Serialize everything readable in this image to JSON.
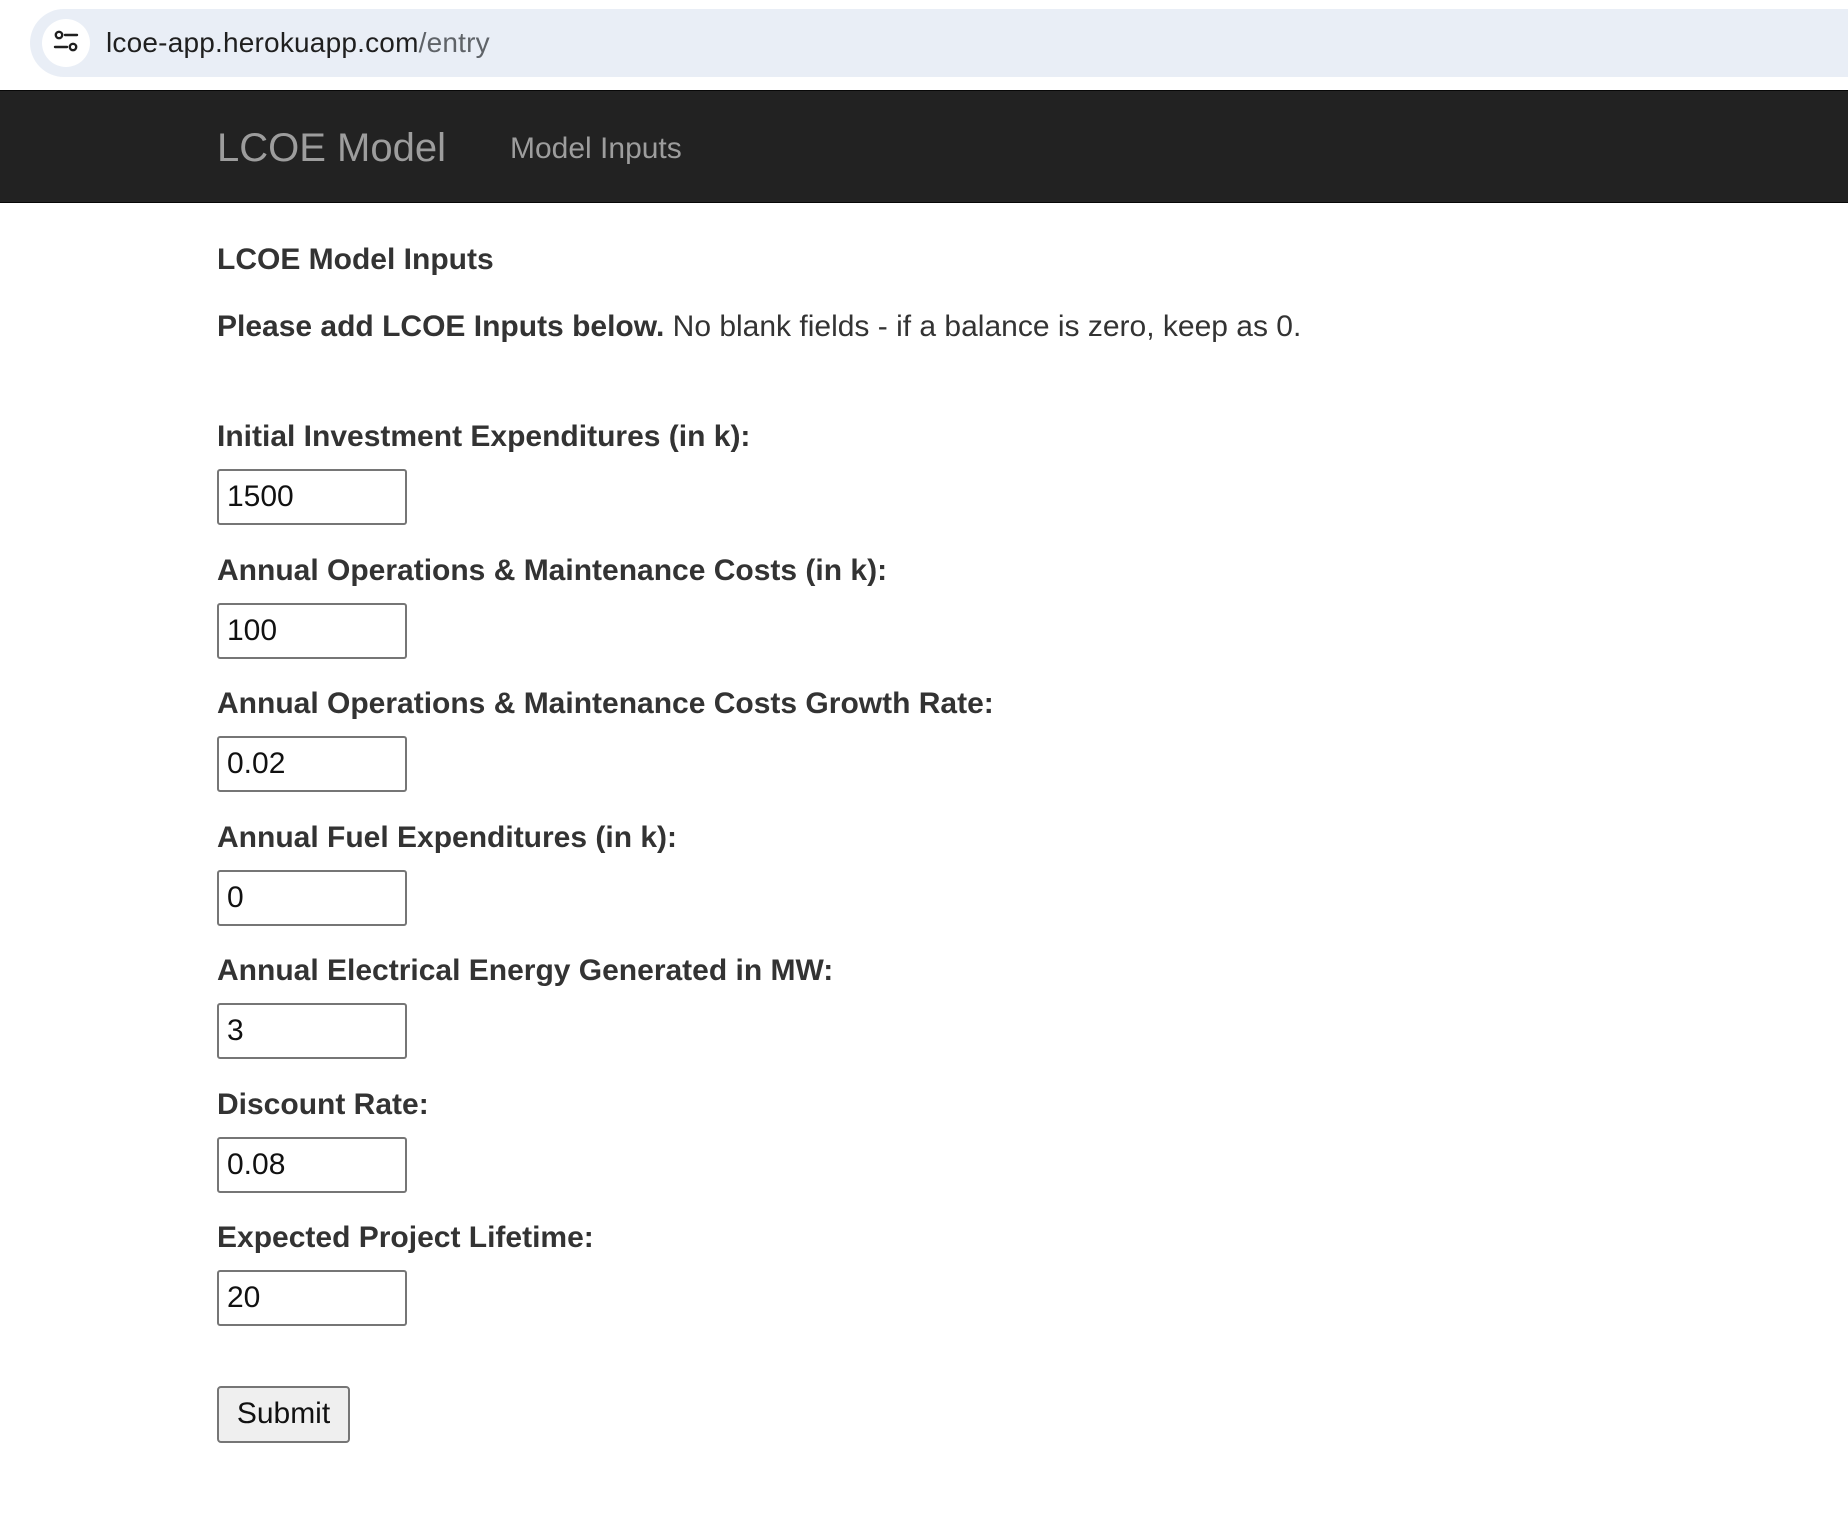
{
  "browser": {
    "url_host": "lcoe-app.herokuapp.com",
    "url_path": "/entry",
    "site_info_icon": "tune-icon"
  },
  "navbar": {
    "brand": "LCOE Model",
    "links": [
      {
        "label": "Model Inputs"
      }
    ]
  },
  "main": {
    "title": "LCOE Model Inputs",
    "instructions_bold": "Please add LCOE Inputs below.",
    "instructions_rest": " No blank fields - if a balance is zero, keep as 0.",
    "fields": [
      {
        "label": "Initial Investment Expenditures (in k):",
        "value": "1500"
      },
      {
        "label": "Annual Operations & Maintenance Costs (in k):",
        "value": "100"
      },
      {
        "label": "Annual Operations & Maintenance Costs Growth Rate:",
        "value": "0.02"
      },
      {
        "label": "Annual Fuel Expenditures (in k):",
        "value": "0"
      },
      {
        "label": "Annual Electrical Energy Generated in MW:",
        "value": "3"
      },
      {
        "label": "Discount Rate:",
        "value": "0.08"
      },
      {
        "label": "Expected Project Lifetime:",
        "value": "20"
      }
    ],
    "submit_label": "Submit"
  }
}
